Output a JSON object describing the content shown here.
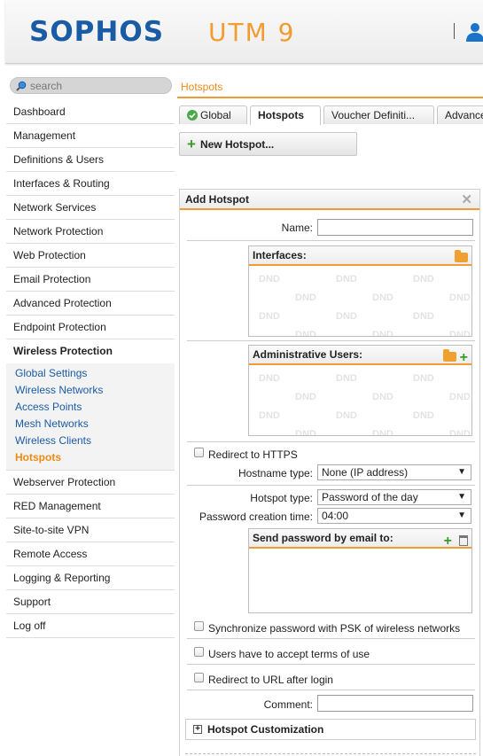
{
  "header": {
    "logo": "SOPHOS",
    "product": "UTM 9"
  },
  "search": {
    "placeholder": "search"
  },
  "sidebar": {
    "items_top": [
      {
        "label": "Dashboard"
      },
      {
        "label": "Management"
      },
      {
        "label": "Definitions & Users"
      },
      {
        "label": "Interfaces & Routing"
      },
      {
        "label": "Network Services"
      },
      {
        "label": "Network Protection"
      },
      {
        "label": "Web Protection"
      },
      {
        "label": "Email Protection"
      },
      {
        "label": "Advanced Protection"
      },
      {
        "label": "Endpoint Protection"
      }
    ],
    "open_item": "Wireless Protection",
    "sub_items": [
      {
        "label": "Global Settings"
      },
      {
        "label": "Wireless Networks"
      },
      {
        "label": "Access Points"
      },
      {
        "label": "Mesh Networks"
      },
      {
        "label": "Wireless Clients"
      },
      {
        "label": "Hotspots"
      }
    ],
    "items_bottom": [
      {
        "label": "Webserver Protection"
      },
      {
        "label": "RED Management"
      },
      {
        "label": "Site-to-site VPN"
      },
      {
        "label": "Remote Access"
      },
      {
        "label": "Logging & Reporting"
      },
      {
        "label": "Support"
      },
      {
        "label": "Log off"
      }
    ]
  },
  "breadcrumb": "Hotspots",
  "tabs": [
    "Global",
    "Hotspots",
    "Voucher Definiti...",
    "Advanced"
  ],
  "new_button": "New Hotspot...",
  "panel": {
    "title": "Add Hotspot",
    "name_label": "Name:",
    "name_value": "",
    "interfaces_title": "Interfaces:",
    "admin_users_title": "Administrative Users:",
    "dnd": "DND",
    "redirect_https": "Redirect to HTTPS",
    "hostname_type_label": "Hostname type:",
    "hostname_type_value": "None (IP address)",
    "hotspot_type_label": "Hotspot type:",
    "hotspot_type_value": "Password of the day",
    "pw_time_label": "Password creation time:",
    "pw_time_value": "04:00",
    "send_pw_title": "Send password by email to:",
    "sync_psk": "Synchronize password with PSK of wireless networks",
    "accept_terms": "Users have to accept terms of use",
    "redirect_url": "Redirect to URL after login",
    "comment_label": "Comment:",
    "comment_value": "",
    "customization": "Hotspot Customization"
  },
  "colors": {
    "brand_blue": "#1a5ba6",
    "accent_orange": "#f29b30",
    "link_blue": "#1a5ba6",
    "active_orange": "#f08a15"
  }
}
